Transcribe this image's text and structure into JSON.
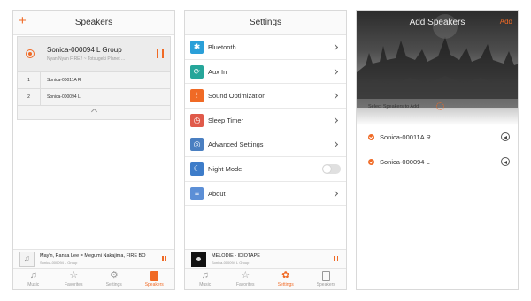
{
  "accent_color": "#f06a25",
  "speakers_screen": {
    "title": "Speakers",
    "add_icon": "+",
    "group": {
      "title": "Sonica-000094 L Group",
      "subtitle": "Nyan Nyan FIRE!! ~ Totsugeki Planet ...",
      "members": [
        {
          "index": "1",
          "name": "Sonica-00011A R"
        },
        {
          "index": "2",
          "name": "Sonica-000094 L"
        }
      ]
    },
    "mini_player": {
      "title": "May'n, Ranka Lee = Megumi Nakajima, FIRE BO",
      "subtitle": "Sonica-000094 L Group"
    },
    "tabs": [
      {
        "label": "Music",
        "icon": "music-note-icon"
      },
      {
        "label": "Favorites",
        "icon": "star-icon"
      },
      {
        "label": "Settings",
        "icon": "gear-icon"
      },
      {
        "label": "Speakers",
        "icon": "speaker-icon"
      }
    ],
    "active_tab": "Speakers"
  },
  "settings_screen": {
    "title": "Settings",
    "items": [
      {
        "label": "Bluetooth",
        "icon": "bluetooth-icon",
        "color": "#2a9fd8",
        "control": "arrow"
      },
      {
        "label": "Aux In",
        "icon": "aux-in-icon",
        "color": "#26a69a",
        "control": "arrow"
      },
      {
        "label": "Sound Optimization",
        "icon": "equalizer-icon",
        "color": "#f06a25",
        "control": "arrow"
      },
      {
        "label": "Sleep Timer",
        "icon": "timer-icon",
        "color": "#e05a4a",
        "control": "arrow"
      },
      {
        "label": "Advanced Settings",
        "icon": "advanced-settings-icon",
        "color": "#4a7fc1",
        "control": "arrow"
      },
      {
        "label": "Night Mode",
        "icon": "moon-icon",
        "color": "#3d7cc9",
        "control": "toggle",
        "toggle_on": false
      },
      {
        "label": "About",
        "icon": "document-icon",
        "color": "#5c8fd6",
        "control": "arrow"
      }
    ],
    "mini_player": {
      "title": "MELODIE - IDIOTAPE",
      "subtitle": "Sonica-000094 L Group"
    },
    "tabs": [
      {
        "label": "Music",
        "icon": "music-note-icon"
      },
      {
        "label": "Favorites",
        "icon": "star-icon"
      },
      {
        "label": "Settings",
        "icon": "gear-icon"
      },
      {
        "label": "Speakers",
        "icon": "speaker-icon"
      }
    ],
    "active_tab": "Settings"
  },
  "add_speakers_screen": {
    "title": "Add Speakers",
    "add_label": "Add",
    "select_label": "Select Speakers to Add",
    "speakers": [
      {
        "name": "Sonica-00011A R",
        "checked": true
      },
      {
        "name": "Sonica-000094 L",
        "checked": true
      }
    ]
  }
}
